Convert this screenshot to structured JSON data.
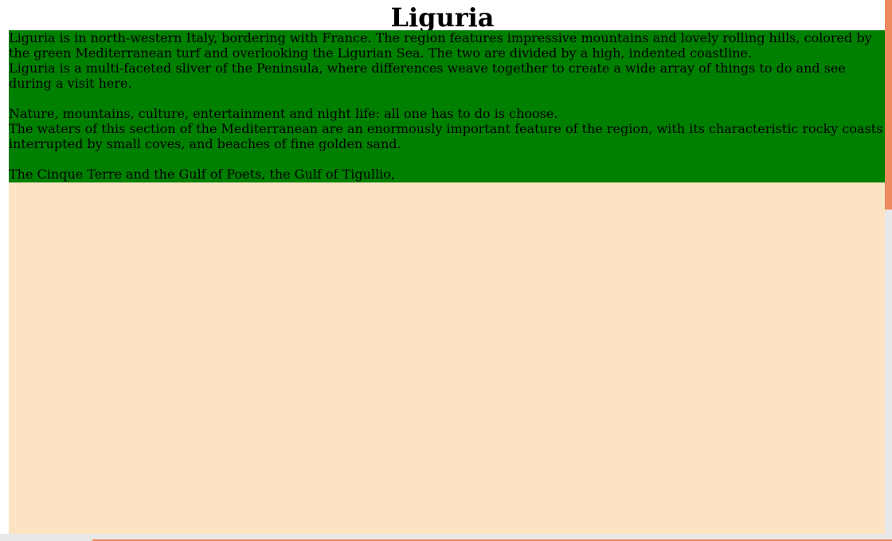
{
  "page": {
    "title": "Liguria",
    "paragraphs": [
      "Liguria is in north-western Italy, bordering with France. The region features impressive mountains and lovely rolling hills, colored by the green Mediterranean turf and overlooking the Ligurian Sea. The two are divided by a high, indented coastline.",
      "Liguria is a multi-faceted sliver of the Peninsula, where differences weave together to create a wide array of things to do and see during a visit here.",
      "Nature, mountains, culture, entertainment and night life: all one has to do is choose.",
      "The waters of this section of the Mediterranean are an enormously important feature of the region, with its characteristic rocky coasts interrupted by small coves, and beaches of fine golden sand.",
      "The Cinque Terre and the Gulf of Poets, the Gulf of Tigullio,"
    ]
  },
  "colors": {
    "content_background": "#008000",
    "frame_background": "#fce3c4",
    "scrollbar_track": "#e8e8e8",
    "scrollbar_thumb": "#ee8a5e"
  },
  "scroll": {
    "vertical_position": 0,
    "horizontal_position": 0.1
  }
}
